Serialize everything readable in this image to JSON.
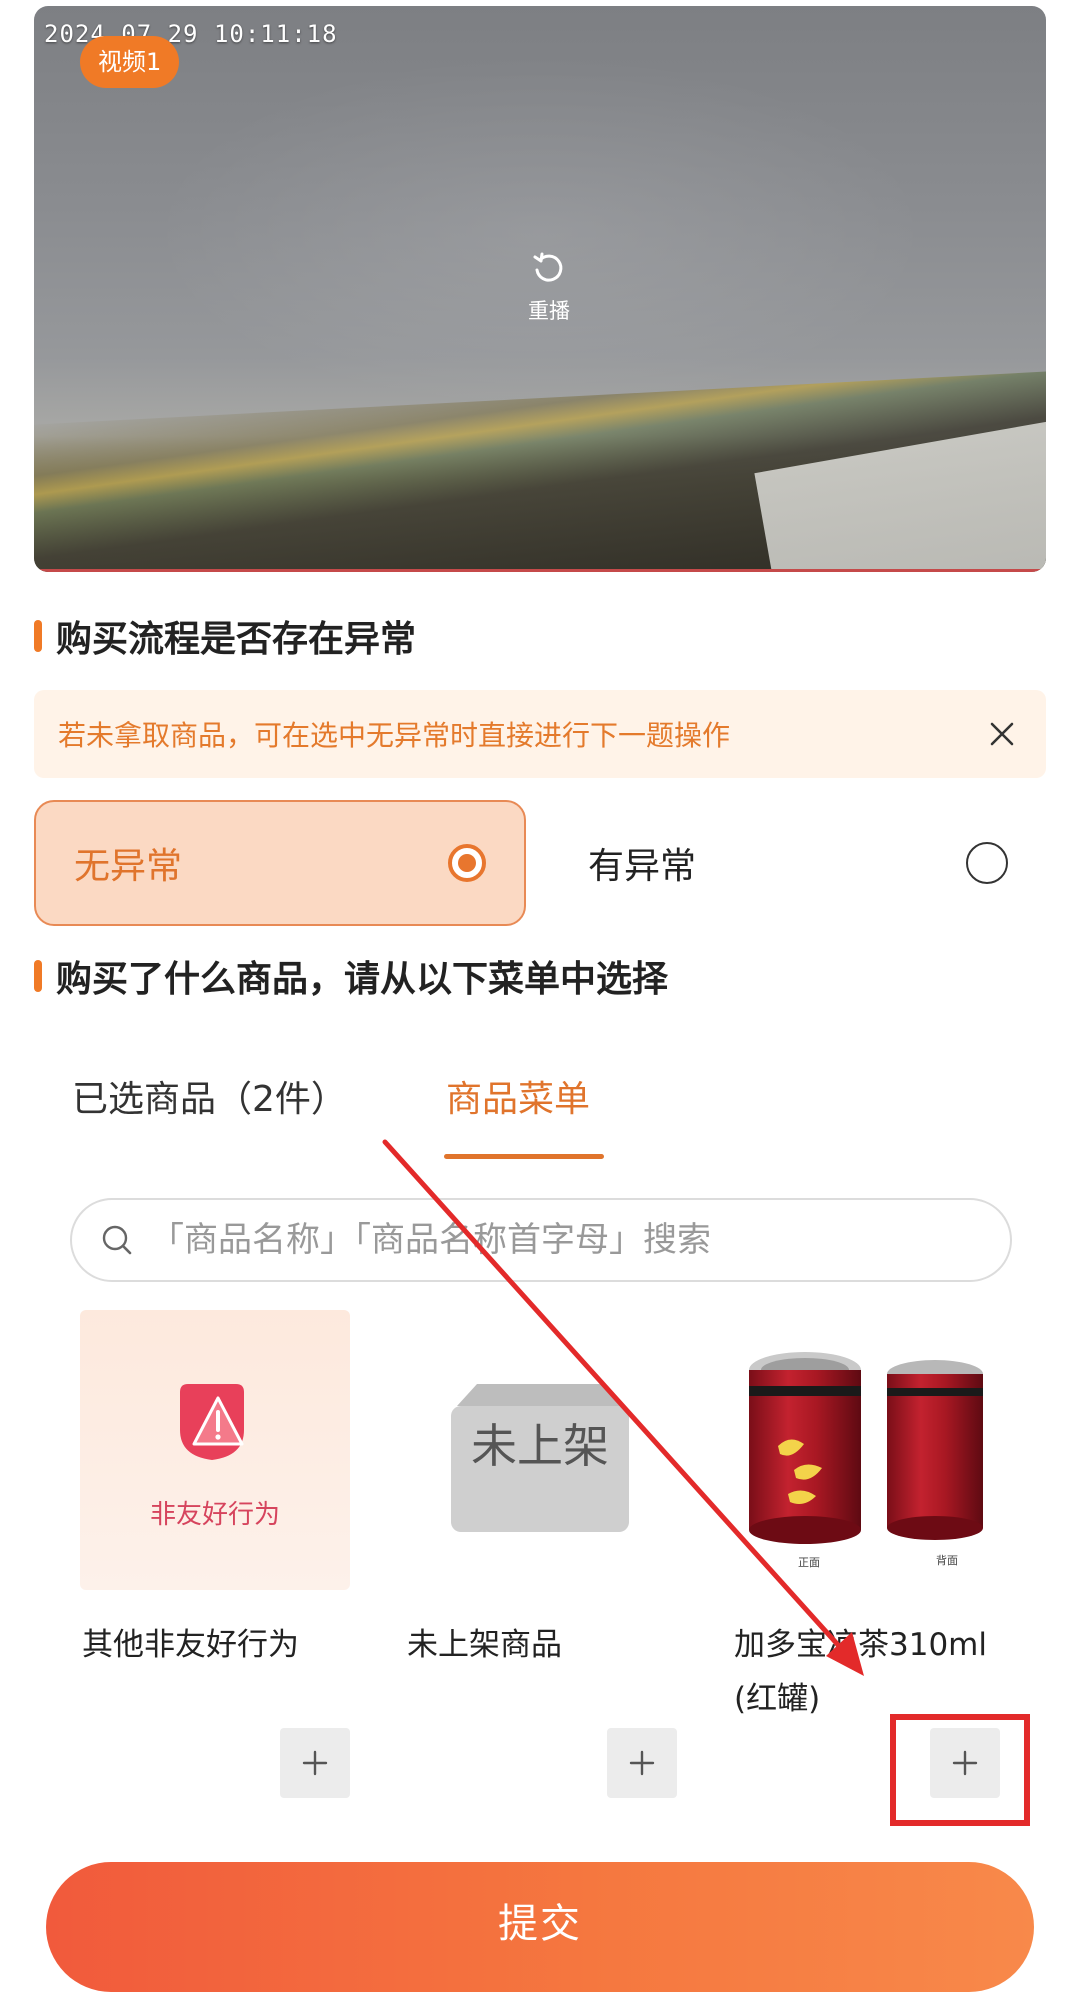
{
  "video": {
    "timestamp": "2024 07 29 10:11:18",
    "tag": "视频1",
    "replay_label": "重播"
  },
  "section1": {
    "title": "购买流程是否存在异常"
  },
  "notice": {
    "text": "若未拿取商品，可在选中无异常时直接进行下一题操作"
  },
  "options": {
    "normal": "无异常",
    "abnormal": "有异常",
    "selected": "无异常"
  },
  "section2": {
    "title": "购买了什么商品，请从以下菜单中选择"
  },
  "tabs": {
    "selected_items": "已选商品（2件）",
    "menu": "商品菜单",
    "active": "商品菜单"
  },
  "search": {
    "placeholder": "「商品名称」「商品名称首字母」搜索",
    "value": ""
  },
  "products": [
    {
      "name": "其他非友好行为",
      "thumb_caption": "非友好行为"
    },
    {
      "name": "未上架商品",
      "thumb_caption": "未上架"
    },
    {
      "name": "加多宝凉茶310ml(红罐)",
      "thumb_front": "正面",
      "thumb_back": "背面"
    }
  ],
  "submit": {
    "label": "提交"
  },
  "colors": {
    "accent": "#e8762e",
    "annotation_red": "#e32a2a"
  }
}
